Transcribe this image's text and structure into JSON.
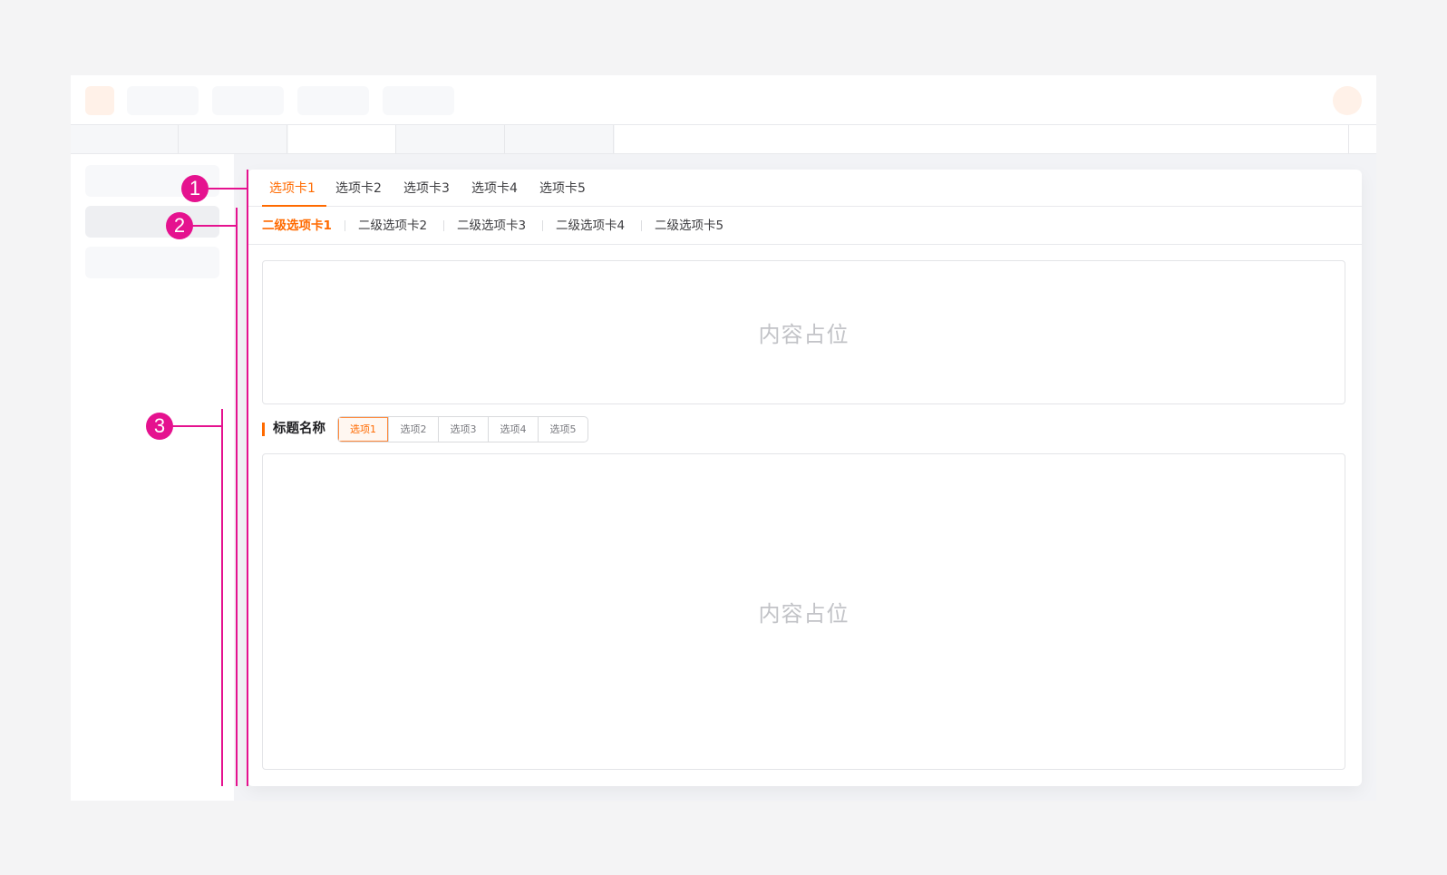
{
  "primary_tabs": {
    "items": [
      "选项卡1",
      "选项卡2",
      "选项卡3",
      "选项卡4",
      "选项卡5"
    ],
    "active_index": 0
  },
  "secondary_tabs": {
    "items": [
      "二级选项卡1",
      "二级选项卡2",
      "二级选项卡3",
      "二级选项卡4",
      "二级选项卡5"
    ],
    "active_index": 0
  },
  "content": {
    "top_placeholder": "内容占位",
    "bottom_placeholder": "内容占位"
  },
  "section": {
    "title": "标题名称",
    "options": [
      "选项1",
      "选项2",
      "选项3",
      "选项4",
      "选项5"
    ],
    "active_index": 0
  },
  "annotations": {
    "markers": [
      "1",
      "2",
      "3"
    ],
    "color": "#e5128f"
  },
  "theme": {
    "accent": "#ff6a00",
    "logo_placeholder_color": "#fff1e8",
    "avatar_placeholder_color": "#fff1e8"
  }
}
